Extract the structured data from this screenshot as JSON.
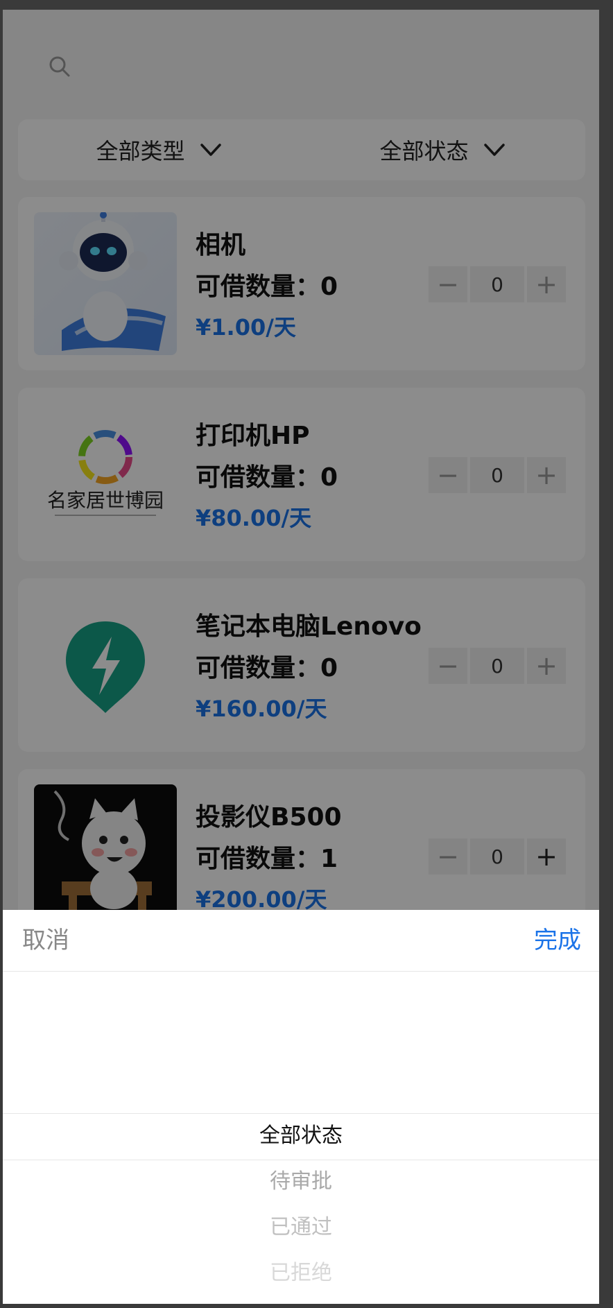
{
  "filters": {
    "type_label": "全部类型",
    "status_label": "全部状态"
  },
  "items": [
    {
      "name": "相机",
      "stock": "可借数量：0",
      "price": "¥1.00/天",
      "qty": "0",
      "thumb": "robot"
    },
    {
      "name": "打印机HP",
      "stock": "可借数量：0",
      "price": "¥80.00/天",
      "qty": "0",
      "thumb": "logo"
    },
    {
      "name": "笔记本电脑Lenovo",
      "stock": "可借数量：0",
      "price": "¥160.00/天",
      "qty": "0",
      "thumb": "bolt"
    },
    {
      "name": "投影仪B500",
      "stock": "可借数量：1",
      "price": "¥200.00/天",
      "qty": "0",
      "thumb": "cartoon"
    }
  ],
  "logo_text": "名家居世博园",
  "stepper": {
    "minus": "−",
    "plus": "+"
  },
  "sheet": {
    "cancel": "取消",
    "done": "完成",
    "options": [
      "全部状态",
      "待审批",
      "已通过",
      "已拒绝"
    ]
  },
  "colors": {
    "accent": "#1a73e8",
    "price": "#1a73e8"
  }
}
